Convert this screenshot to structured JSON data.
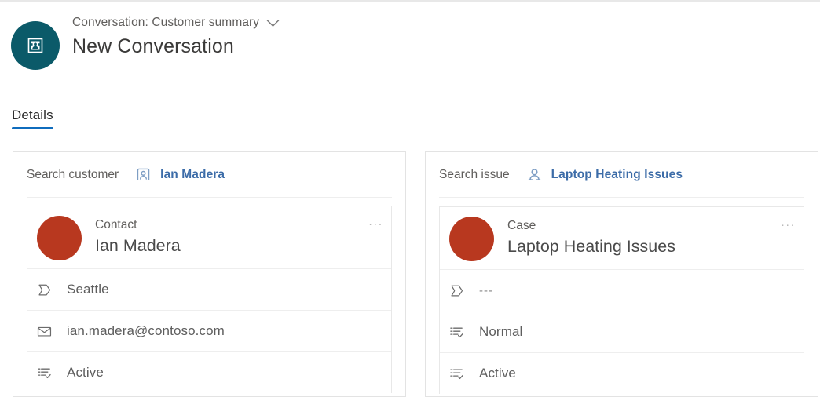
{
  "header": {
    "avatar_icon": "conversation-summary-icon",
    "avatar_color": "#0b5a69",
    "subtitle": "Conversation: Customer summary",
    "chevron_icon": "chevron-down-icon",
    "title": "New Conversation"
  },
  "tabs": [
    {
      "label": "Details",
      "active": true,
      "accent": "#0f6cbd"
    }
  ],
  "cards": [
    {
      "id": "customer-card",
      "search": {
        "label": "Search customer",
        "icon": "contact-record-icon",
        "value": "Ian Madera",
        "value_color": "#3c6ca8"
      },
      "record": {
        "avatar_color": "#b8381f",
        "type": "Contact",
        "name": "Ian Madera",
        "overflow": "...",
        "fields": [
          {
            "icon": "tag-icon",
            "value": "Seattle",
            "muted": false
          },
          {
            "icon": "email-icon",
            "value": "ian.madera@contoso.com",
            "muted": false
          },
          {
            "icon": "status-icon",
            "value": "Active",
            "muted": false
          }
        ]
      }
    },
    {
      "id": "issue-card",
      "search": {
        "label": "Search issue",
        "icon": "case-record-icon",
        "value": "Laptop Heating Issues",
        "value_color": "#3c6ca8"
      },
      "record": {
        "avatar_color": "#b8381f",
        "type": "Case",
        "name": "Laptop Heating Issues",
        "overflow": "...",
        "fields": [
          {
            "icon": "tag-icon",
            "value": "---",
            "muted": true
          },
          {
            "icon": "status-icon",
            "value": "Normal",
            "muted": false
          },
          {
            "icon": "status-icon",
            "value": "Active",
            "muted": false
          }
        ]
      }
    }
  ]
}
